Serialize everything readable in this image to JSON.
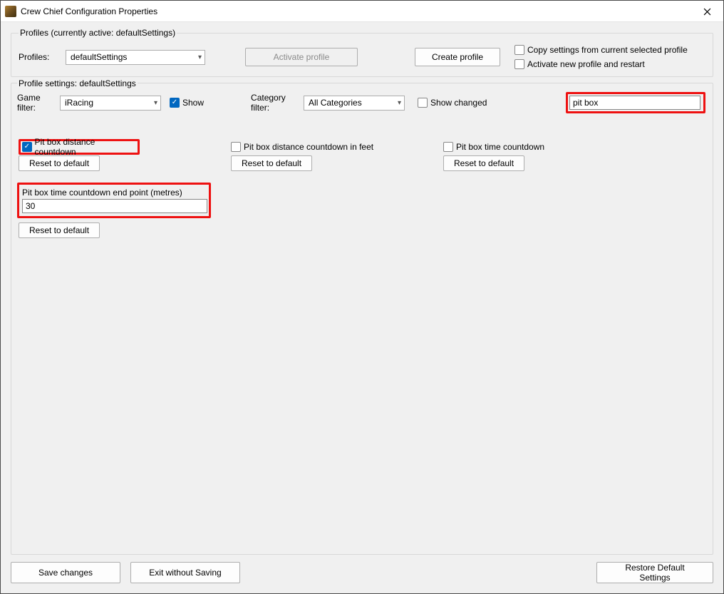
{
  "window": {
    "title": "Crew Chief Configuration Properties"
  },
  "profiles": {
    "legend": "Profiles (currently active: defaultSettings)",
    "profiles_label": "Profiles:",
    "selected_profile": "defaultSettings",
    "activate_btn": "Activate profile",
    "create_btn": "Create profile",
    "copy_chk": "Copy settings from current selected profile",
    "activate_restart_chk": "Activate new profile and restart"
  },
  "settings": {
    "legend": "Profile settings: defaultSettings",
    "game_filter_label": "Game filter:",
    "game_filter_value": "iRacing",
    "show_chk": "Show",
    "category_filter_label": "Category filter:",
    "category_filter_value": "All Categories",
    "show_changed_chk": "Show changed",
    "search_value": "pit box",
    "reset_btn": "Reset to default",
    "items": [
      {
        "label": "Pit box distance countdown",
        "type": "checkbox",
        "checked": true,
        "highlight": true
      },
      {
        "label": "Pit box distance countdown in feet",
        "type": "checkbox",
        "checked": false
      },
      {
        "label": "Pit box time countdown",
        "type": "checkbox",
        "checked": false
      },
      {
        "label": "Pit box time countdown end point (metres)",
        "type": "text",
        "value": "30",
        "highlight": true
      }
    ]
  },
  "footer": {
    "save": "Save changes",
    "exit": "Exit without Saving",
    "restore": "Restore Default Settings"
  }
}
